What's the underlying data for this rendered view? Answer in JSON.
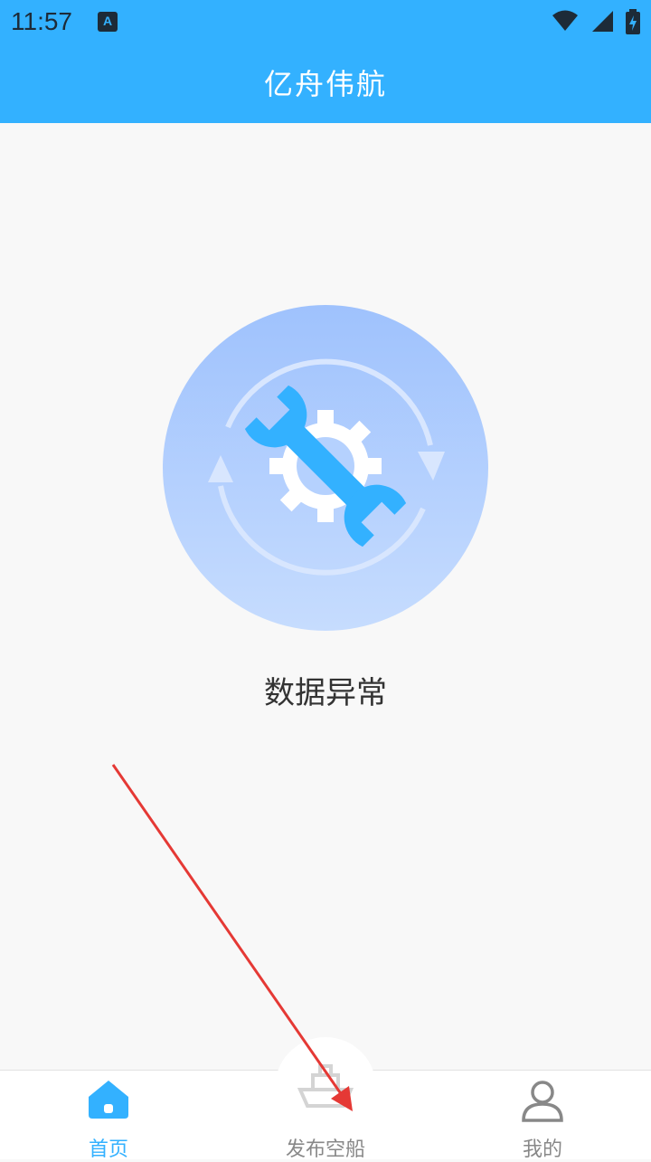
{
  "status_bar": {
    "time": "11:57",
    "notification_icon_letter": "A",
    "icons": [
      "wifi-icon",
      "signal-icon",
      "battery-charging-icon"
    ]
  },
  "header": {
    "title": "亿舟伟航"
  },
  "main": {
    "illustration_icon": "maintenance-wrench-gear-icon",
    "message": "数据异常"
  },
  "tabbar": {
    "tabs": [
      {
        "label": "首页",
        "icon": "home-icon",
        "active": true
      },
      {
        "label": "发布空船",
        "icon": "ship-icon",
        "active": false
      },
      {
        "label": "我的",
        "icon": "user-icon",
        "active": false
      }
    ]
  },
  "colors": {
    "primary": "#33b1ff",
    "background": "#f8f8f8",
    "tab_inactive": "#888888",
    "annotation_arrow": "#e53935"
  }
}
